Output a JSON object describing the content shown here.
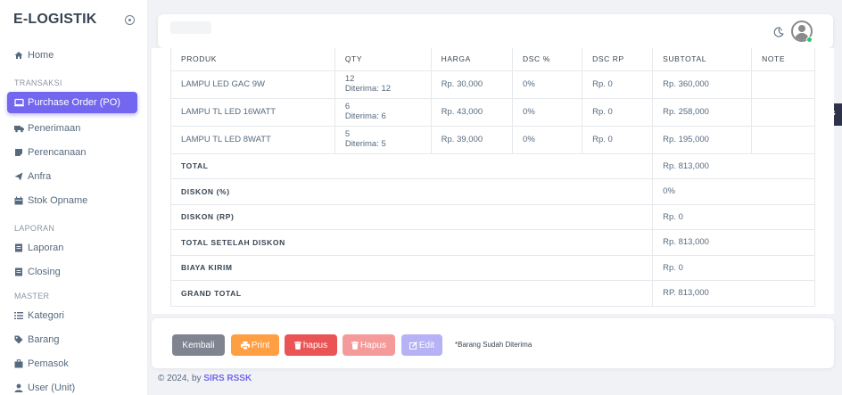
{
  "sidebar": {
    "brand": "E-LOGISTIK",
    "items": [
      {
        "label": "Home",
        "icon": "home-icon"
      },
      {
        "label": "Purchase Order (PO)",
        "icon": "monitor-icon",
        "active": true
      },
      {
        "label": "Penerimaan",
        "icon": "truck-icon"
      },
      {
        "label": "Perencanaan",
        "icon": "sticky-note-icon"
      },
      {
        "label": "Anfra",
        "icon": "paper-plane-icon"
      },
      {
        "label": "Stok Opname",
        "icon": "calendar-icon"
      },
      {
        "label": "Laporan",
        "icon": "document-icon"
      },
      {
        "label": "Closing",
        "icon": "document-icon"
      },
      {
        "label": "Kategori",
        "icon": "list-icon"
      },
      {
        "label": "Barang",
        "icon": "tag-icon"
      },
      {
        "label": "Pemasok",
        "icon": "briefcase-icon"
      },
      {
        "label": "User (Unit)",
        "icon": "user-icon"
      }
    ],
    "sections": [
      "TRANSAKSI",
      "LAPORAN",
      "MASTER"
    ]
  },
  "table": {
    "headers": [
      "PRODUK",
      "QTY",
      "HARGA",
      "DSC %",
      "DSC RP",
      "SUBTOTAL",
      "NOTE"
    ],
    "rows": [
      {
        "produk": "LAMPU LED GAC 9W",
        "qty": "12",
        "diterima": "Diterima: 12",
        "harga": "Rp. 30,000",
        "dsc_pct": "0%",
        "dsc_rp": "Rp. 0",
        "subtotal": "Rp. 360,000",
        "note": ""
      },
      {
        "produk": "LAMPU TL LED 16WATT",
        "qty": "6",
        "diterima": "Diterima: 6",
        "harga": "Rp. 43,000",
        "dsc_pct": "0%",
        "dsc_rp": "Rp. 0",
        "subtotal": "Rp. 258,000",
        "note": ""
      },
      {
        "produk": "LAMPU TL LED 8WATT",
        "qty": "5",
        "diterima": "Diterima: 5",
        "harga": "Rp. 39,000",
        "dsc_pct": "0%",
        "dsc_rp": "Rp. 0",
        "subtotal": "Rp. 195,000",
        "note": ""
      }
    ],
    "summary": [
      {
        "label": "TOTAL",
        "value": "Rp. 813,000"
      },
      {
        "label": "DISKON (%)",
        "value": "0%"
      },
      {
        "label": "DISKON (RP)",
        "value": "Rp. 0"
      },
      {
        "label": "TOTAL SETELAH DISKON",
        "value": "Rp. 813,000"
      },
      {
        "label": "BIAYA KIRIM",
        "value": "Rp. 0"
      },
      {
        "label": "GRAND TOTAL",
        "value": "RP. 813,000"
      }
    ]
  },
  "actions": {
    "back": "Kembali",
    "print": "Print",
    "hapus": "hapus",
    "hapus_disabled": "Hapus",
    "edit": "Edit",
    "note": "*Barang Sudah Diterima"
  },
  "footer": {
    "prefix": "© 2024, by ",
    "link": "SIRS RSSK"
  },
  "colors": {
    "accent": "#7367f0",
    "secondary": "#808390",
    "warning": "#ff9f43",
    "danger": "#ea5455",
    "success": "#28c76f"
  }
}
